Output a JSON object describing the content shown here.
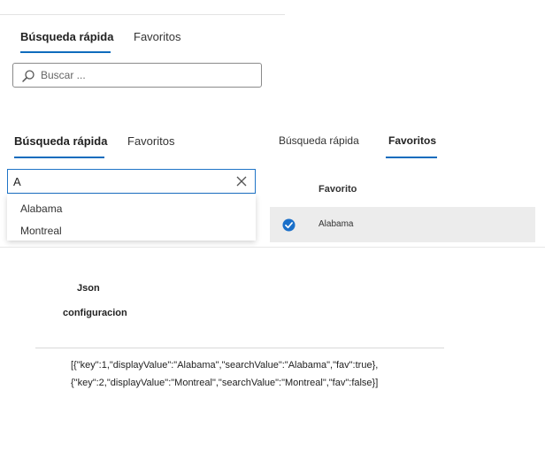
{
  "panel1": {
    "tabs": [
      {
        "label": "Búsqueda rápida",
        "active": true
      },
      {
        "label": "Favoritos",
        "active": false
      }
    ],
    "search": {
      "placeholder": "Buscar ...",
      "value": ""
    }
  },
  "panel2": {
    "tabs": [
      {
        "label": "Búsqueda rápida",
        "active": true
      },
      {
        "label": "Favoritos",
        "active": false
      }
    ],
    "search": {
      "value": "A"
    },
    "options": [
      "Alabama",
      "Montreal"
    ]
  },
  "panel3": {
    "tabs": [
      {
        "label": "Búsqueda rápida",
        "active": false
      },
      {
        "label": "Favoritos",
        "active": true
      }
    ],
    "column_header": "Favorito",
    "rows": [
      {
        "label": "Alabama",
        "checked": true
      }
    ]
  },
  "json_section": {
    "title_line1": "Json",
    "title_line2": "configuracion",
    "line1": "[{\"key\":1,\"displayValue\":\"Alabama\",\"searchValue\":\"Alabama\",\"fav\":true},",
    "line2": "{\"key\":2,\"displayValue\":\"Montreal\",\"searchValue\":\"Montreal\",\"fav\":false}]"
  },
  "colors": {
    "accent": "#0f6cbd",
    "check": "#1a6fc9"
  }
}
